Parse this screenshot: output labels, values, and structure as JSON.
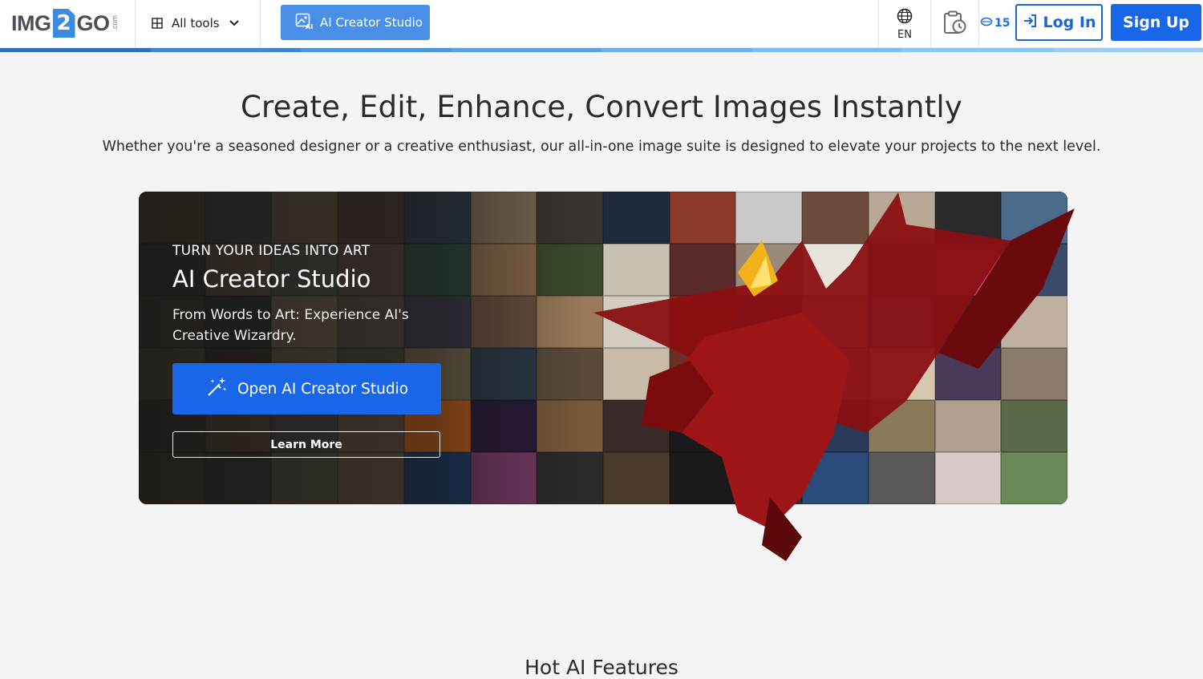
{
  "header": {
    "logo": {
      "img": "IMG",
      "two": "2",
      "go": "GO",
      "com": ".com"
    },
    "all_tools_label": "All tools",
    "ai_studio_label": "AI Creator Studio",
    "language": "EN",
    "credits": "15",
    "login_label": "Log In",
    "signup_label": "Sign Up",
    "progress_colors": [
      "#2f6fb8",
      "#3f86d0",
      "#4c94dc",
      "#5aa2e4",
      "#6bb0ea",
      "#7cbcef",
      "#8cc6f1",
      "#9dcff3"
    ]
  },
  "hero": {
    "title": "Create, Edit, Enhance, Convert Images Instantly",
    "subtitle": "Whether you're a seasoned designer or a creative enthusiast, our all-in-one image suite is designed to elevate your projects to the next level."
  },
  "banner": {
    "kicker": "TURN YOUR IDEAS INTO ART",
    "title": "AI Creator Studio",
    "description": "From Words to Art: Experience AI's Creative Wizardry.",
    "open_label": "Open AI Creator Studio",
    "learn_more_label": "Learn More",
    "tile_colors": [
      "#5a4a3c",
      "#3d4a3e",
      "#6b5a48",
      "#4a3a33",
      "#2d3a4a",
      "#7a6a55",
      "#3a3430",
      "#1e2a3a",
      "#8b3a2a",
      "#c9c9c9",
      "#6e4a3a",
      "#b8a894",
      "#2a2a2a",
      "#4a6a8a",
      "#3e3a34",
      "#6a5a4a",
      "#4a5a4a",
      "#5a4a44",
      "#2a4a3a",
      "#8a6a4a",
      "#3a4a2a",
      "#c8c0b0",
      "#5a2a2a",
      "#9a8a7a",
      "#e8e4dc",
      "#7a5a4a",
      "#c45a8a",
      "#3a4a6a",
      "#4a4038",
      "#2a3a30",
      "#7a6a5a",
      "#5a5048",
      "#3a3a4a",
      "#6a5040",
      "#9a7a5a",
      "#d4ccc0",
      "#8a2a22",
      "#3a3028",
      "#b8b0a0",
      "#5a7aaa",
      "#2a2a3a",
      "#c0b0a0",
      "#5a5248",
      "#3a302a",
      "#6a6050",
      "#4a4a40",
      "#7a6a50",
      "#2a3a4a",
      "#5a4a3a",
      "#c8bca8",
      "#6a3028",
      "#2a2420",
      "#a8a090",
      "#d8c8b0",
      "#4a3a5a",
      "#8a7a6a",
      "#3a3a30",
      "#5a4a3a",
      "#4a4a4a",
      "#6a5a48",
      "#c8601a",
      "#2a1a3a",
      "#7a5a3a",
      "#3a2a2a",
      "#1a1a1a",
      "#5a4a3a",
      "#2a3a5a",
      "#8a7a5a",
      "#b0a090",
      "#5a6a4a",
      "#4a4238",
      "#3a3a34",
      "#5a5448",
      "#6a5a4a",
      "#1a3a6a",
      "#7a3a6a",
      "#2a2a2a",
      "#4a3a2a",
      "#1a1a1a",
      "#3a2a2a",
      "#2a4a7a",
      "#5a5a5a",
      "#d8c8c8",
      "#6a8a5a"
    ]
  },
  "next_section_title": "Hot AI Features"
}
